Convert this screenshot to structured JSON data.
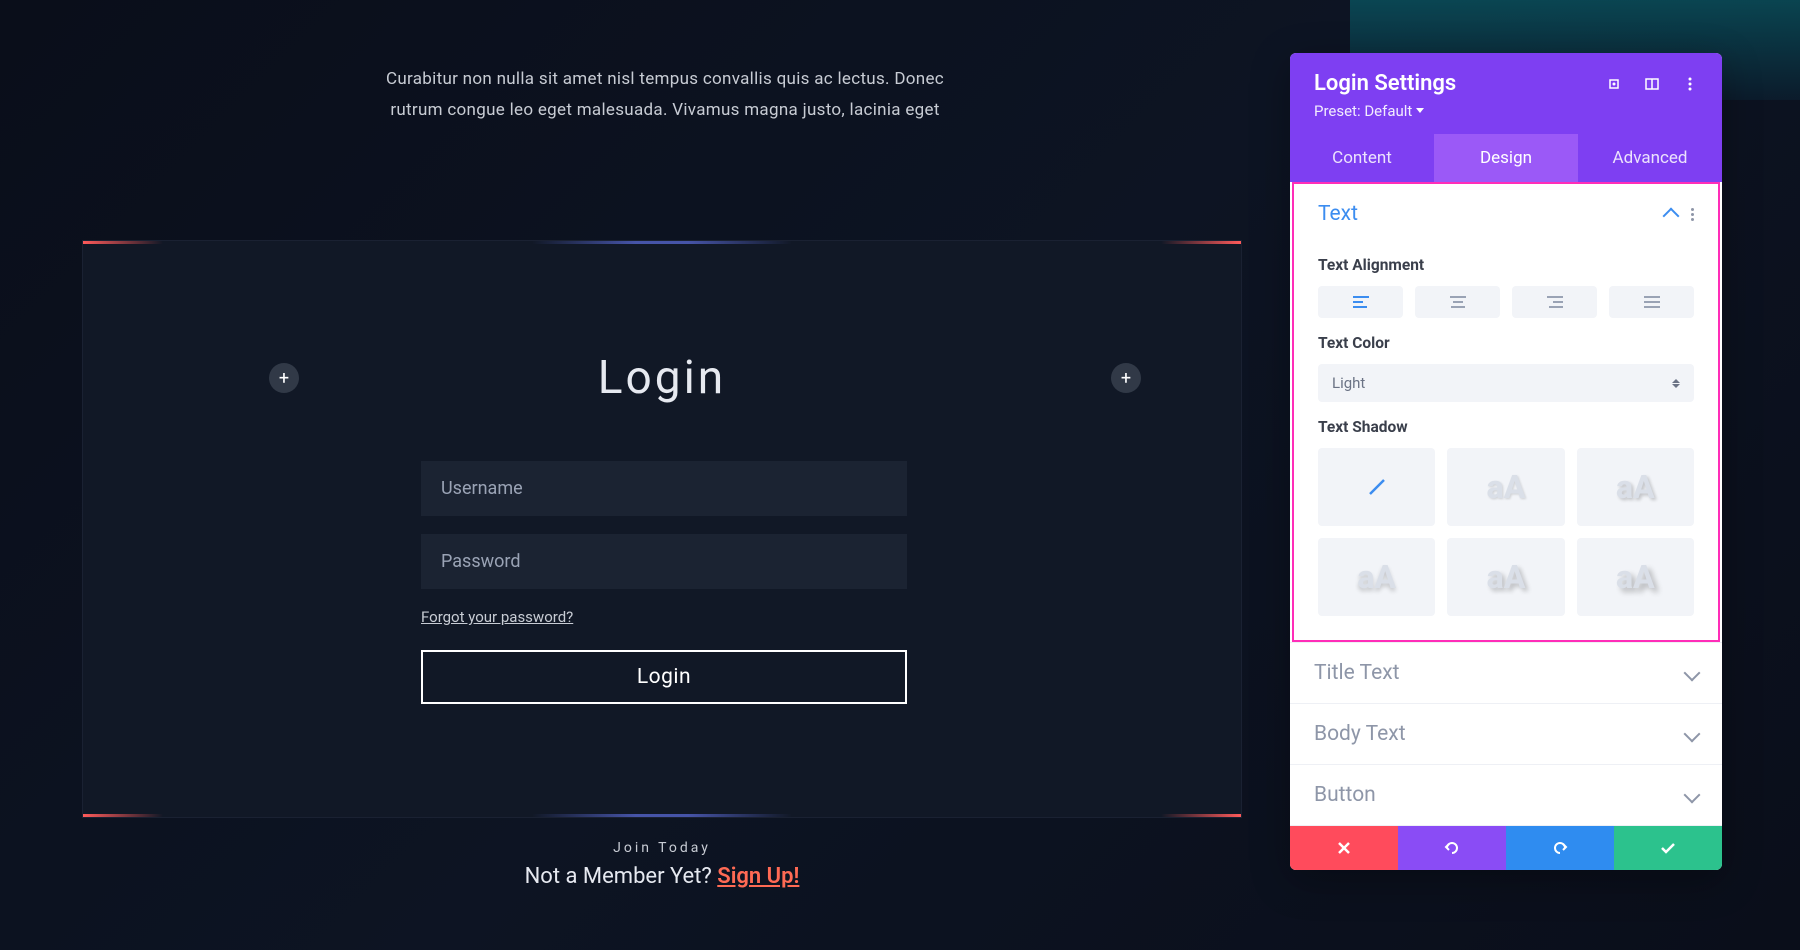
{
  "intro_text": "Curabitur non nulla sit amet nisl tempus convallis quis ac lectus. Donec rutrum congue leo eget malesuada. Vivamus magna justo, lacinia eget",
  "login": {
    "title": "Login",
    "username_placeholder": "Username",
    "password_placeholder": "Password",
    "forgot_label": "Forgot your password?",
    "button_label": "Login"
  },
  "join": {
    "tagline": "Join Today",
    "question": "Not a Member Yet?",
    "link_label": "Sign Up!"
  },
  "panel": {
    "title": "Login Settings",
    "preset_label": "Preset: Default",
    "tabs": {
      "content": "Content",
      "design": "Design",
      "advanced": "Advanced"
    },
    "sections": {
      "text": {
        "title": "Text",
        "alignment_label": "Text Alignment",
        "color_label": "Text Color",
        "color_value": "Light",
        "shadow_label": "Text Shadow"
      },
      "title_text": "Title Text",
      "body_text": "Body Text",
      "button": "Button"
    }
  }
}
